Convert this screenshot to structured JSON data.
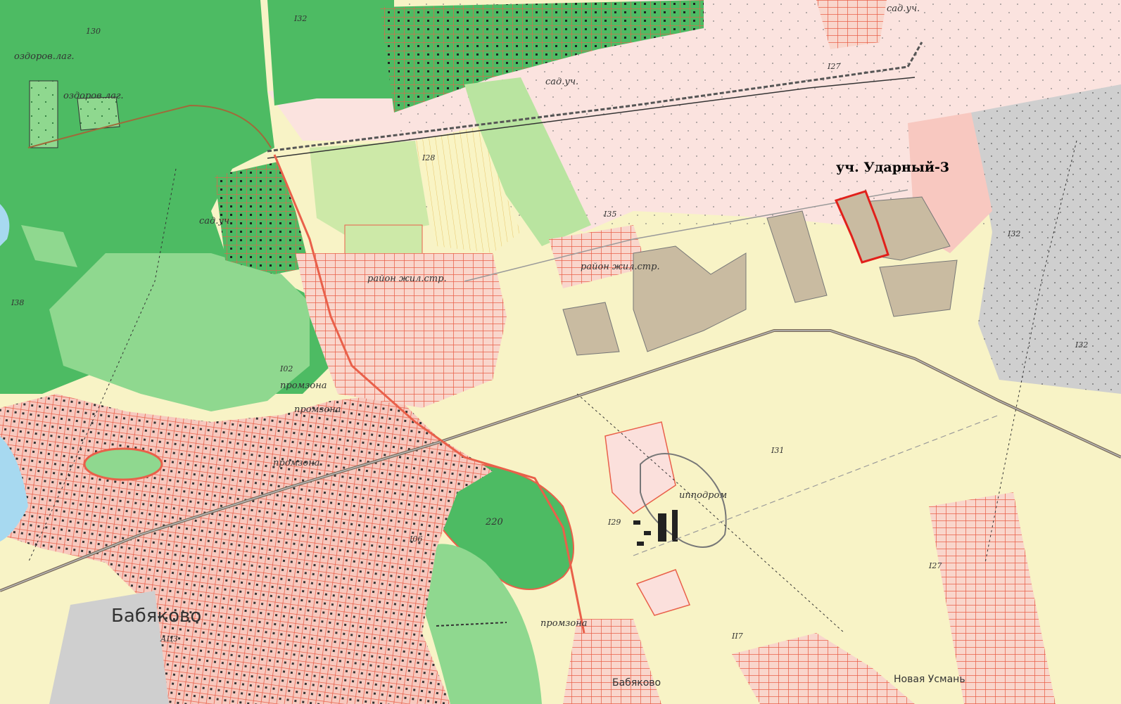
{
  "map": {
    "highlight_label": "уч. Ударный-3",
    "place_labels": {
      "town_babyakovo": "Бабяково",
      "town_babyakovo_small": "Бабяково",
      "novaya_usman": "Новая Усмань",
      "hippodrome": "ипподром",
      "camp_1": "оздоров.лаг.",
      "camp_2": "оздоров.лаг.",
      "garden_1": "сад.уч.",
      "garden_2": "сад.уч.",
      "garden_3": "сад.уч.",
      "industrial_1": "промзона",
      "industrial_2": "промзона",
      "industrial_3": "промзона",
      "industrial_4": "промзона",
      "housing_1": "район жил.стр.",
      "housing_2": "район жил.стр.",
      "station_1": "АЦЗ"
    },
    "height_labels": {
      "h130": "130",
      "h132a": "I32",
      "h127a": "I27",
      "h128": "I28",
      "h135": "I35",
      "h138": "I38",
      "h102": "I02",
      "h132b": "I32",
      "h132c": "I32",
      "h131": "I31",
      "h129": "I29",
      "h220": "220",
      "h127b": "I27",
      "h117": "II7",
      "h106": "I06"
    },
    "colors": {
      "forest": "#4dbb63",
      "light_forest": "#8fd88f",
      "urban": "#e9604a",
      "urban_fill": "#f7c9bf",
      "field": "#f9f4c4",
      "farmland": "#fbe0dc",
      "industrial": "#c7c7c7",
      "quarry": "#c9bba1",
      "highlight": "#e1201b"
    }
  }
}
